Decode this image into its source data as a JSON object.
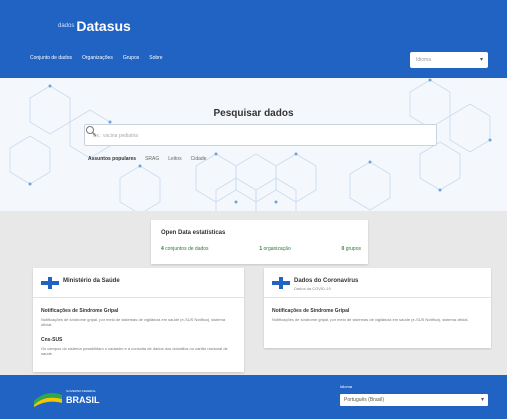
{
  "header": {
    "logo_prefix": "dados",
    "logo_main": "Datasus",
    "nav": [
      "Conjunto de dados",
      "Organizações",
      "Grupos",
      "Sobre"
    ],
    "language_placeholder": "Idioma"
  },
  "hero": {
    "title": "Pesquisar dados",
    "search_placeholder": "Ex.: vacina pediatria",
    "popular_label": "Assuntos populares",
    "tags": [
      "SRAG",
      "Leitos",
      "Cidade"
    ]
  },
  "stats": {
    "title": "Open Data estatísticas",
    "items": [
      {
        "num": "4",
        "label": "conjuntos de dados"
      },
      {
        "num": "1",
        "label": "organização"
      },
      {
        "num": "0",
        "label": "grupos"
      }
    ]
  },
  "card_left": {
    "title": "Ministério da Saúde",
    "item_title": "Notificações de Síndrome Gripal",
    "item_desc": "Notificações de síndrome gripal, por meio de sistemas de vigilância em saúde (e-SUS Notifica), sistema oficial.",
    "item2_title": "Cns-SUS",
    "item2_desc": "Os campos do sistema possibilitam o cadastro e a consulta de dados dos cidadãos no cartão nacional de saúde."
  },
  "card_right": {
    "title": "Dados do Coronavírus",
    "subtitle": "Dados da COVID-19",
    "item_title": "Notificações de Síndrome Gripal",
    "item_desc": "Notificações de síndrome gripal, por meio de sistemas de vigilância em saúde (e-SUS Notifica), sistema oficial."
  },
  "footer": {
    "gov_small": "GOVERNO FEDERAL",
    "gov_name": "BRASIL",
    "lang_label": "Idioma",
    "lang_value": "Português (Brasil)"
  },
  "colors": {
    "primary": "#2063c3",
    "accent_green": "#2e7d32"
  }
}
